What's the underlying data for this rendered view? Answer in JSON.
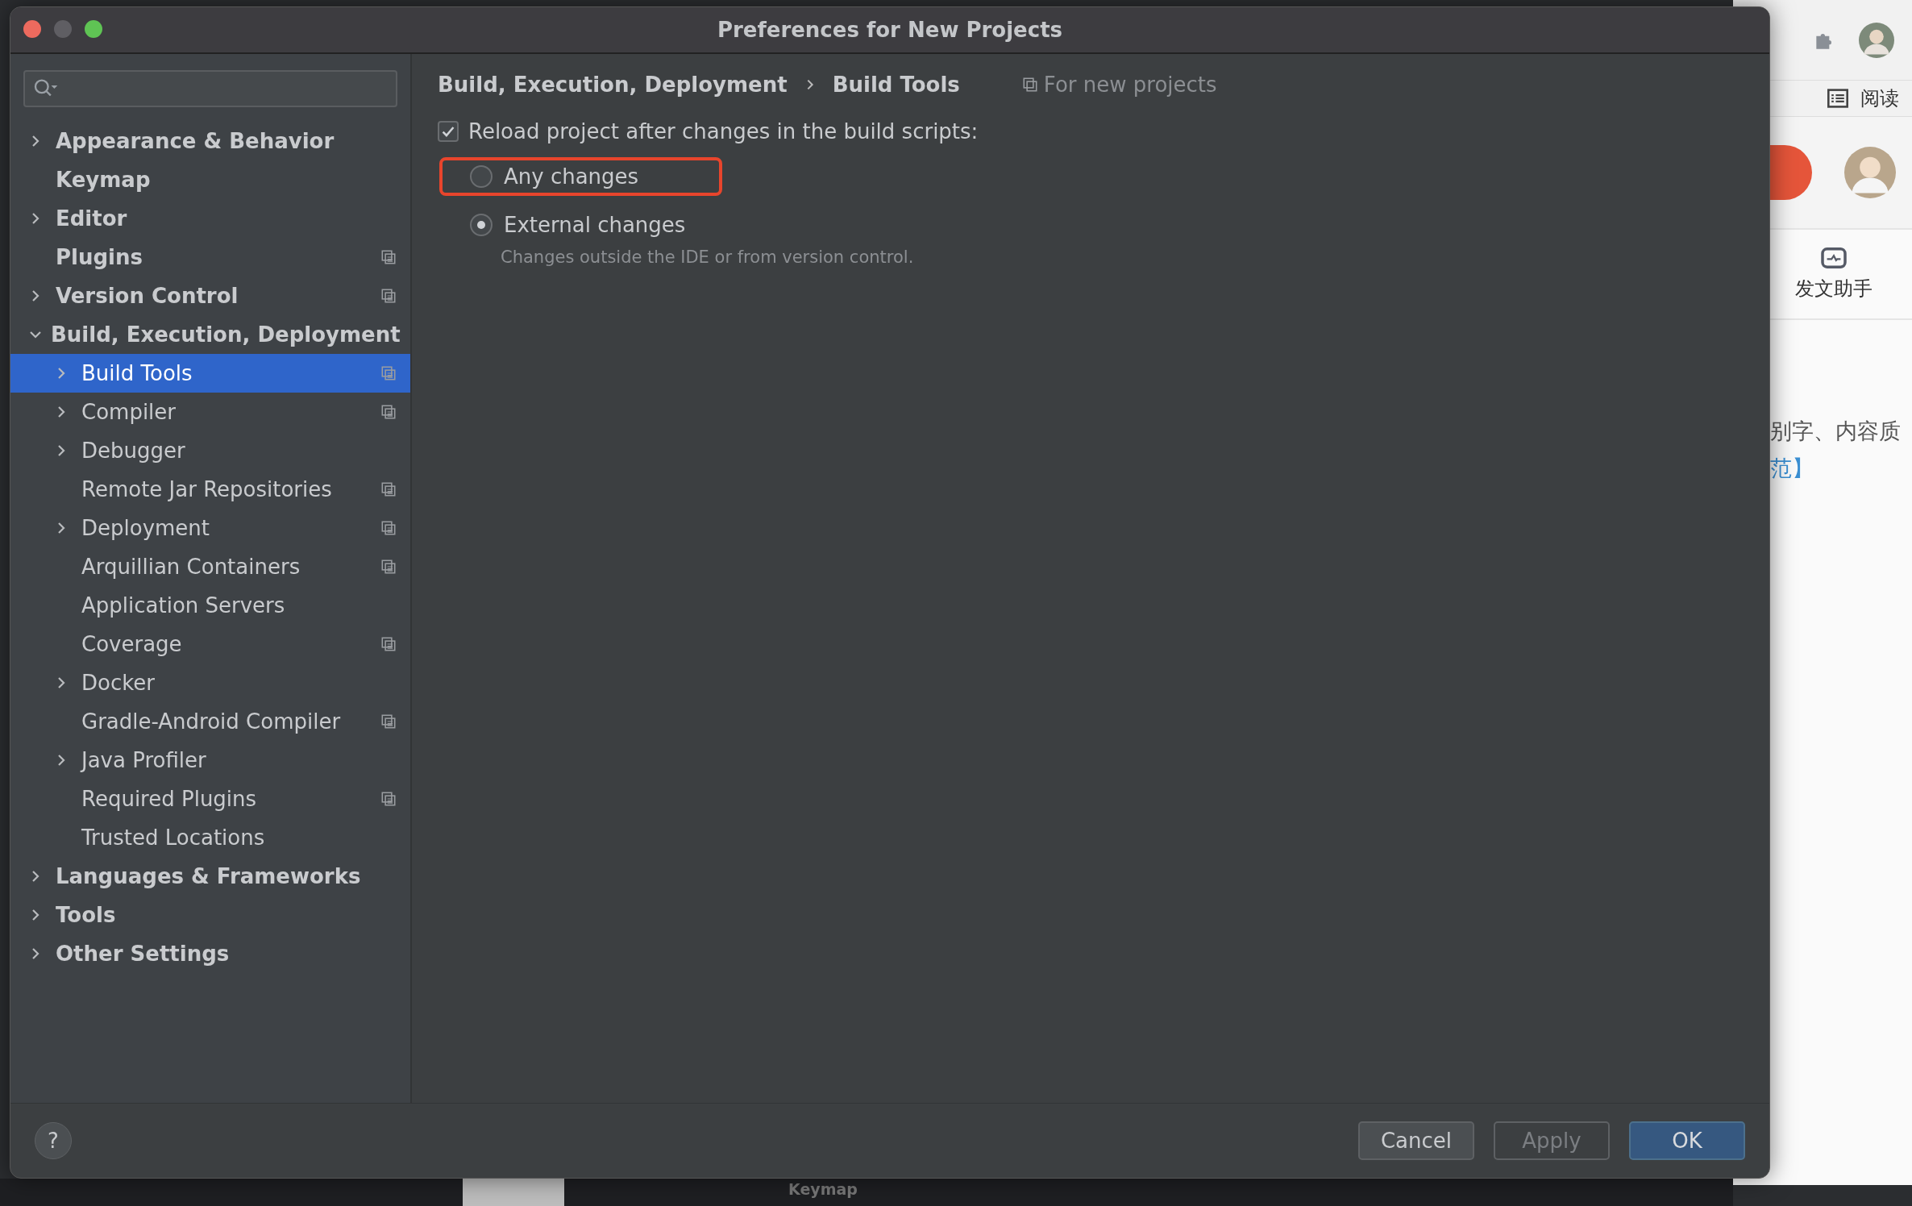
{
  "window": {
    "title": "Preferences for New Projects"
  },
  "sidebar": {
    "items": [
      {
        "label": "Appearance & Behavior",
        "expandable": true,
        "expanded": false,
        "selected": false,
        "project_icon": false
      },
      {
        "label": "Keymap",
        "expandable": false,
        "selected": false,
        "project_icon": false
      },
      {
        "label": "Editor",
        "expandable": true,
        "expanded": false,
        "selected": false,
        "project_icon": false
      },
      {
        "label": "Plugins",
        "expandable": false,
        "selected": false,
        "project_icon": true
      },
      {
        "label": "Version Control",
        "expandable": true,
        "expanded": false,
        "selected": false,
        "project_icon": true
      },
      {
        "label": "Build, Execution, Deployment",
        "expandable": true,
        "expanded": true,
        "selected": false,
        "project_icon": false,
        "children": [
          {
            "label": "Build Tools",
            "expandable": true,
            "expanded": false,
            "selected": true,
            "project_icon": true
          },
          {
            "label": "Compiler",
            "expandable": true,
            "expanded": false,
            "selected": false,
            "project_icon": true
          },
          {
            "label": "Debugger",
            "expandable": true,
            "expanded": false,
            "selected": false,
            "project_icon": false
          },
          {
            "label": "Remote Jar Repositories",
            "expandable": false,
            "selected": false,
            "project_icon": true
          },
          {
            "label": "Deployment",
            "expandable": true,
            "expanded": false,
            "selected": false,
            "project_icon": true
          },
          {
            "label": "Arquillian Containers",
            "expandable": false,
            "selected": false,
            "project_icon": true
          },
          {
            "label": "Application Servers",
            "expandable": false,
            "selected": false,
            "project_icon": false
          },
          {
            "label": "Coverage",
            "expandable": false,
            "selected": false,
            "project_icon": true
          },
          {
            "label": "Docker",
            "expandable": true,
            "expanded": false,
            "selected": false,
            "project_icon": false
          },
          {
            "label": "Gradle-Android Compiler",
            "expandable": false,
            "selected": false,
            "project_icon": true
          },
          {
            "label": "Java Profiler",
            "expandable": true,
            "expanded": false,
            "selected": false,
            "project_icon": false
          },
          {
            "label": "Required Plugins",
            "expandable": false,
            "selected": false,
            "project_icon": true
          },
          {
            "label": "Trusted Locations",
            "expandable": false,
            "selected": false,
            "project_icon": false
          }
        ]
      },
      {
        "label": "Languages & Frameworks",
        "expandable": true,
        "expanded": false,
        "selected": false,
        "project_icon": false
      },
      {
        "label": "Tools",
        "expandable": true,
        "expanded": false,
        "selected": false,
        "project_icon": false
      },
      {
        "label": "Other Settings",
        "expandable": true,
        "expanded": false,
        "selected": false,
        "project_icon": false
      }
    ]
  },
  "content": {
    "breadcrumb": [
      "Build, Execution, Deployment",
      "Build Tools"
    ],
    "scope_note": "For new projects",
    "reload_checkbox": {
      "label": "Reload project after changes in the build scripts:",
      "checked": true
    },
    "options": [
      {
        "label": "Any changes",
        "selected": false,
        "highlighted": true
      },
      {
        "label": "External changes",
        "selected": true,
        "highlighted": false,
        "hint": "Changes outside the IDE or from version control."
      }
    ]
  },
  "footer": {
    "help": "?",
    "buttons": [
      {
        "label": "Cancel",
        "kind": "normal"
      },
      {
        "label": "Apply",
        "kind": "disabled"
      },
      {
        "label": "OK",
        "kind": "default"
      }
    ]
  },
  "background": {
    "reading_mode": "阅读",
    "toolbar_item": "发文助手",
    "text_lines": [
      {
        "text": "别字、内容质",
        "kind": "plain"
      },
      {
        "text": "范】",
        "kind": "link"
      }
    ],
    "bottom_tab": "Keymap"
  }
}
